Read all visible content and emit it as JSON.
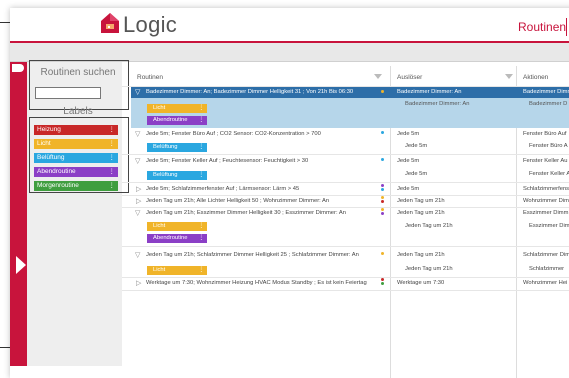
{
  "app": {
    "title": "Logic",
    "nav_active": "Routinen"
  },
  "colors": {
    "accent": "#c8143c",
    "heizung": "#c82828",
    "licht": "#f0b429",
    "beluftung": "#2aa7e0",
    "abendroutine": "#8b3fc6",
    "morgenroutine": "#3f9e3f",
    "selected_row": "#2d6ea8",
    "selected_sub": "#b6d6ea"
  },
  "sidebar": {
    "search_label": "Routinen suchen",
    "search_value": "",
    "labels_title": "Labels",
    "labels": [
      {
        "name": "Heizung",
        "color": "#c82828"
      },
      {
        "name": "Licht",
        "color": "#f0b429"
      },
      {
        "name": "Belüftung",
        "color": "#2aa7e0"
      },
      {
        "name": "Abendroutine",
        "color": "#8b3fc6"
      },
      {
        "name": "Morgenroutine",
        "color": "#3f9e3f"
      }
    ]
  },
  "table": {
    "columns": [
      "Routinen",
      "Auslöser",
      "Aktionen"
    ],
    "rows": [
      {
        "routine": "Badezimmer Dimmer: An; Badezimmer Dimmer Helligkeit 31 ; Von 21h Bis 06:30",
        "trigger": "Badezimmer Dimmer: An",
        "trigger_sub": "Badezimmer Dimmer: An",
        "action": "Badezimmer Dimmer",
        "action_sub": "Badezimmer D",
        "labels": [
          "Licht",
          "Abendroutine"
        ]
      },
      {
        "routine": "Jede 5m; Fenster Büro Auf ; CO2 Sensor: CO2-Konzentration > 700",
        "trigger": "Jede 5m",
        "trigger_sub": "Jede 5m",
        "action": "Fenster Büro Auf",
        "action_sub": "Fenster Büro A",
        "labels": [
          "Belüftung"
        ]
      },
      {
        "routine": "Jede 5m; Fenster Keller Auf ; Feuchtesensor: Feuchtigkeit > 30",
        "trigger": "Jede 5m",
        "trigger_sub": "Jede 5m",
        "action": "Fenster Keller Au",
        "action_sub": "Fenster Keller A",
        "labels": [
          "Belüftung"
        ]
      },
      {
        "routine": "Jede 5m; Schlafzimmerfenster Auf ; Lärmsensor: Lärm > 45",
        "trigger": "Jede 5m",
        "action": "Schlafzimmerfenster",
        "labels": []
      },
      {
        "routine": "Jeden Tag um 21h; Alle Lichter Helligkeit 50 ; Wohnzimmer Dimmer: An",
        "trigger": "Jeden Tag um 21h",
        "action": "Wohnzimmer Dimm",
        "labels": []
      },
      {
        "routine": "Jeden Tag um 21h; Esszimmer Dimmer Helligkeit 30 ; Esszimmer Dimmer: An",
        "trigger": "Jeden Tag um 21h",
        "trigger_sub": "Jeden Tag um 21h",
        "action": "Esszimmer Dimm",
        "action_sub": "Esszimmer Dim",
        "labels": [
          "Licht",
          "Abendroutine"
        ]
      },
      {
        "routine": "Jeden Tag um 21h; Schlafzimmer Dimmer Helligkeit 25 ; Schlafzimmer Dimmer: An",
        "trigger": "Jeden Tag um 21h",
        "trigger_sub": "Jeden Tag um 21h",
        "action": "Schlafzimmer Dim",
        "action_sub": "Schlafzimmer",
        "labels": [
          "Licht"
        ]
      },
      {
        "routine": "Werktage um 7:30; Wohnzimmer Heizung HVAC Modus Standby ; Es ist kein Feiertag",
        "trigger": "Werktage um 7:30",
        "action": "Wohnzimmer Hei",
        "labels": []
      }
    ]
  }
}
